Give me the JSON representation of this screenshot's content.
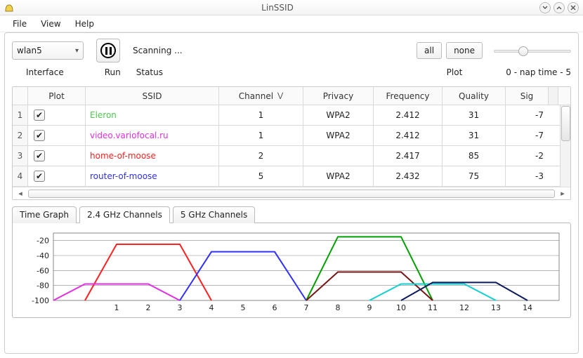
{
  "app_title": "LinSSID",
  "menubar": [
    "File",
    "View",
    "Help"
  ],
  "toolbar": {
    "interface_value": "wlan5",
    "status_text": "Scanning ...",
    "plot_all": "all",
    "plot_none": "none"
  },
  "labels": {
    "interface": "Interface",
    "run": "Run",
    "status": "Status",
    "plot": "Plot",
    "naptime": "0 - nap time - 5"
  },
  "table": {
    "headers": {
      "plot": "Plot",
      "ssid": "SSID",
      "channel": "Channel",
      "privacy": "Privacy",
      "frequency": "Frequency",
      "quality": "Quality",
      "signal": "Sig"
    },
    "rows": [
      {
        "idx": "1",
        "ssid": "Eleron",
        "ssid_color": "#4cc94c",
        "channel": "1",
        "privacy": "WPA2",
        "frequency": "2.412",
        "quality": "31",
        "signal": "-7"
      },
      {
        "idx": "2",
        "ssid": "video.variofocal.ru",
        "ssid_color": "#e030e0",
        "channel": "1",
        "privacy": "WPA2",
        "frequency": "2.412",
        "quality": "31",
        "signal": "-7"
      },
      {
        "idx": "3",
        "ssid": "home-of-moose",
        "ssid_color": "#ff2020",
        "channel": "2",
        "privacy": "",
        "frequency": "2.417",
        "quality": "85",
        "signal": "-2"
      },
      {
        "idx": "4",
        "ssid": "router-of-moose",
        "ssid_color": "#3030ff",
        "channel": "5",
        "privacy": "WPA2",
        "frequency": "2.432",
        "quality": "75",
        "signal": "-3"
      }
    ]
  },
  "tabs": {
    "items": [
      "Time Graph",
      "2.4 GHz Channels",
      "5 GHz Channels"
    ],
    "active": 1
  },
  "chart_data": {
    "type": "line",
    "xlabel": "",
    "ylabel": "",
    "x_ticks": [
      1,
      2,
      3,
      4,
      5,
      6,
      7,
      8,
      9,
      10,
      11,
      12,
      13,
      14
    ],
    "y_ticks": [
      -20,
      -40,
      -60,
      -80,
      -100
    ],
    "xlim": [
      -1,
      15
    ],
    "ylim": [
      -100,
      -10
    ],
    "series": [
      {
        "name": "red",
        "color": "#ff2020",
        "points": [
          [
            0,
            -100
          ],
          [
            1,
            -25
          ],
          [
            3,
            -25
          ],
          [
            4,
            -100
          ]
        ]
      },
      {
        "name": "magenta",
        "color": "#e030e0",
        "points": [
          [
            -1,
            -100
          ],
          [
            0,
            -78
          ],
          [
            2,
            -78
          ],
          [
            3,
            -100
          ]
        ]
      },
      {
        "name": "blue",
        "color": "#3030ff",
        "points": [
          [
            3,
            -100
          ],
          [
            4,
            -35
          ],
          [
            6,
            -35
          ],
          [
            7,
            -100
          ]
        ]
      },
      {
        "name": "green",
        "color": "#00a000",
        "points": [
          [
            7,
            -100
          ],
          [
            8,
            -15
          ],
          [
            10,
            -15
          ],
          [
            11,
            -100
          ]
        ]
      },
      {
        "name": "darkred",
        "color": "#7a1515",
        "points": [
          [
            7,
            -100
          ],
          [
            8,
            -62
          ],
          [
            10,
            -62
          ],
          [
            11,
            -100
          ]
        ]
      },
      {
        "name": "cyan",
        "color": "#10d0d0",
        "points": [
          [
            9,
            -100
          ],
          [
            10,
            -78
          ],
          [
            12,
            -78
          ],
          [
            13,
            -100
          ]
        ]
      },
      {
        "name": "navy",
        "color": "#0b1b60",
        "points": [
          [
            10,
            -100
          ],
          [
            11,
            -76
          ],
          [
            13,
            -76
          ],
          [
            14,
            -100
          ]
        ]
      }
    ]
  }
}
